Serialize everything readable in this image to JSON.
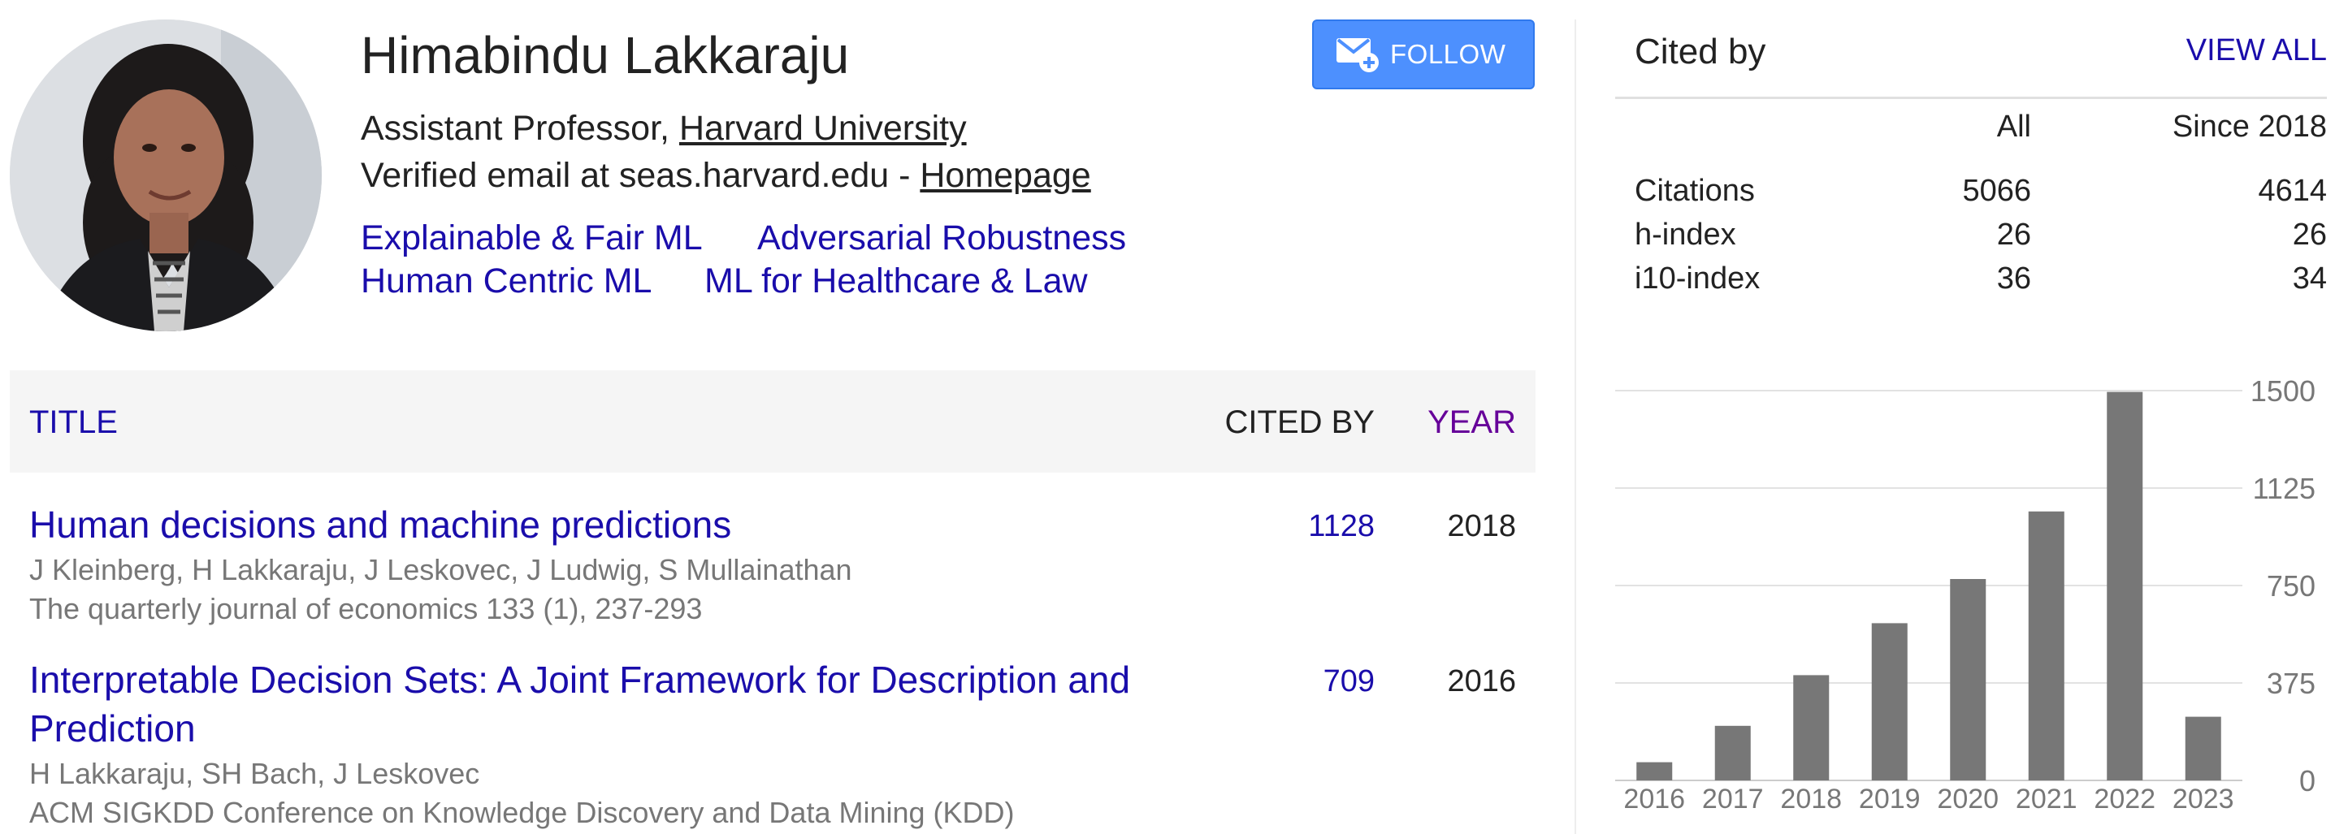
{
  "profile": {
    "name": "Himabindu Lakkaraju",
    "affiliation_prefix": "Assistant Professor, ",
    "affiliation_link": "Harvard University",
    "email_prefix": "Verified email at seas.harvard.edu - ",
    "homepage_link": "Homepage",
    "interests": [
      "Explainable & Fair ML",
      "Adversarial Robustness",
      "Human Centric ML",
      "ML for Healthcare & Law"
    ],
    "follow_label": "FOLLOW"
  },
  "table": {
    "headers": {
      "title": "TITLE",
      "cited_by": "CITED BY",
      "year": "YEAR"
    },
    "rows": [
      {
        "title": "Human decisions and machine predictions",
        "authors": "J Kleinberg, H Lakkaraju, J Leskovec, J Ludwig, S Mullainathan",
        "venue": "The quarterly journal of economics 133 (1), 237-293",
        "cited_by": "1128",
        "year": "2018"
      },
      {
        "title": "Interpretable Decision Sets: A Joint Framework for Description and Prediction",
        "authors": "H Lakkaraju, SH Bach, J Leskovec",
        "venue": "ACM SIGKDD Conference on Knowledge Discovery and Data Mining (KDD)",
        "cited_by": "709",
        "year": "2016"
      }
    ]
  },
  "cited_by": {
    "title": "Cited by",
    "view_all": "VIEW ALL",
    "columns": {
      "all": "All",
      "since": "Since 2018"
    },
    "rows": [
      {
        "label": "Citations",
        "all": "5066",
        "since": "4614"
      },
      {
        "label": "h-index",
        "all": "26",
        "since": "26"
      },
      {
        "label": "i10-index",
        "all": "36",
        "since": "34"
      }
    ]
  },
  "chart_data": {
    "type": "bar",
    "categories": [
      "2016",
      "2017",
      "2018",
      "2019",
      "2020",
      "2021",
      "2022",
      "2023"
    ],
    "values": [
      70,
      210,
      405,
      605,
      775,
      1035,
      1495,
      245
    ],
    "yticks": [
      0,
      375,
      750,
      1125,
      1500
    ],
    "ylim": [
      0,
      1500
    ],
    "y_axis_position": "right",
    "grid": true,
    "bar_color": "#777777"
  },
  "colors": {
    "link": "#1a0dab",
    "year_header": "#660099",
    "follow_button": "#4d90fe",
    "header_bg": "#f5f5f5"
  }
}
